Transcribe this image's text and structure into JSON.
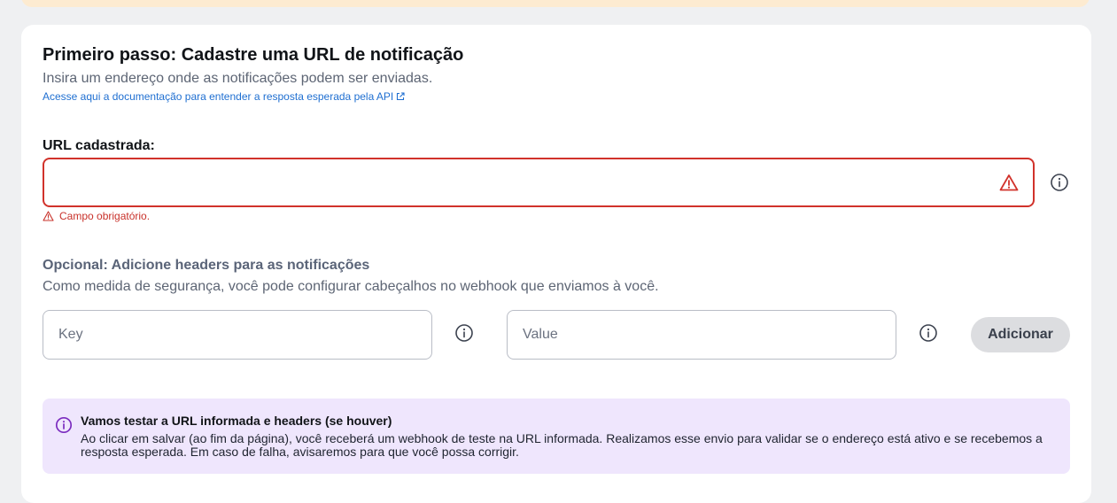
{
  "section": {
    "title": "Primeiro passo: Cadastre uma URL de notificação",
    "subtitle": "Insira um endereço onde as notificações podem ser enviadas.",
    "doc_link": "Acesse aqui a documentação para entender a resposta esperada pela API"
  },
  "url_field": {
    "label": "URL cadastrada:",
    "value": "",
    "placeholder": "",
    "error": "Campo obrigatório."
  },
  "headers": {
    "title": "Opcional: Adicione headers para as notificações",
    "description": "Como medida de segurança, você pode configurar cabeçalhos no webhook que enviamos à você.",
    "key_placeholder": "Key",
    "value_placeholder": "Value",
    "add_button": "Adicionar"
  },
  "notice": {
    "title": "Vamos testar a URL informada e headers (se houver)",
    "text": "Ao clicar em salvar (ao fim da página), você receberá um webhook de teste na URL informada. Realizamos esse envio para validar se o endereço está ativo e se recebemos a resposta esperada. Em caso de falha, avisaremos para que você possa corrigir."
  },
  "icons": {
    "external_link": "external-link-icon",
    "warning": "warning-icon",
    "info": "info-icon"
  },
  "colors": {
    "error": "#d1322b",
    "link": "#1f6fd1",
    "notice_bg": "#efe6fd",
    "notice_icon": "#7b2cbf",
    "banner": "#fdebd1"
  }
}
